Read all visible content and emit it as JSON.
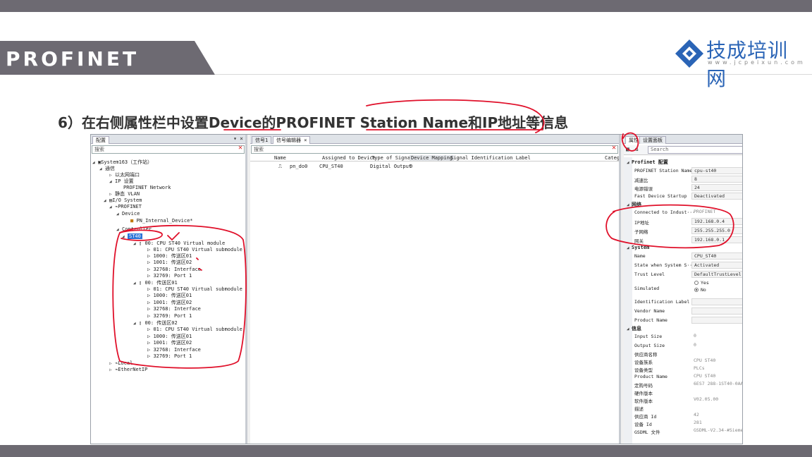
{
  "slide": {
    "title": "PROFINET",
    "logo_text": "技成培训网",
    "logo_url": "www.jcpeixun.com",
    "instruction": "6）在右侧属性栏中设置Device的PROFINET Station Name和IP地址等信息"
  },
  "colors": {
    "bar": "#6d6a72",
    "accent": "#2a64b6",
    "annotation": "#e0102a",
    "selection": "#2b74d8"
  },
  "left_pane": {
    "tab": "配置",
    "search_placeholder": "搜索",
    "tree": [
      {
        "label": "System163（工作站）"
      },
      {
        "label": "通信"
      },
      {
        "label": "以太网端口"
      },
      {
        "label": "IP 设置"
      },
      {
        "label": "PROFINET Network"
      },
      {
        "label": "静态 VLAN"
      },
      {
        "label": "I/O System"
      },
      {
        "label": "PROFINET"
      },
      {
        "label": "Device"
      },
      {
        "label": "PN_Internal_Device"
      },
      {
        "label": "Controller"
      },
      {
        "label": "ST40"
      },
      {
        "label": "00: CPU ST40 Virtual module"
      },
      {
        "label": "01: CPU ST40 Virtual submodule"
      },
      {
        "label": "1000: 传送区01"
      },
      {
        "label": "1001: 传送区02"
      },
      {
        "label": "32768: Interface"
      },
      {
        "label": "32769: Port 1"
      },
      {
        "label": "00: 传送区01"
      },
      {
        "label": "01: CPU ST40 Virtual submodule"
      },
      {
        "label": "1000: 传送区01"
      },
      {
        "label": "1001: 传送区02"
      },
      {
        "label": "32768: Interface"
      },
      {
        "label": "32769: Port 1"
      },
      {
        "label": "00: 传送区02"
      },
      {
        "label": "01: CPU ST40 Virtual submodule"
      },
      {
        "label": "1000: 传送区01"
      },
      {
        "label": "1001: 传送区02"
      },
      {
        "label": "32768: Interface"
      },
      {
        "label": "32769: Port 1"
      },
      {
        "label": "Local"
      },
      {
        "label": "EtherNetIP"
      }
    ]
  },
  "mid_pane": {
    "tabs": [
      "信号1",
      "信号编辑器"
    ],
    "search_placeholder": "搜索",
    "columns": [
      "Name",
      "Assigned to Device",
      "Type of Signal",
      "Device Mapping",
      "Signal Identification Label",
      "Catego"
    ],
    "rows": [
      {
        "name": "pn_do0",
        "device": "CPU_ST40",
        "type": "Digital Output",
        "mapping": "0"
      }
    ]
  },
  "right_pane": {
    "tabs": [
      "属性",
      "设置面板"
    ],
    "search_placeholder": "Search",
    "categories": {
      "profinet": "Profinet 配置",
      "network": "网络",
      "system": "System",
      "info": "信息"
    },
    "profinet_rows": [
      {
        "label": "PROFINET Station Name",
        "value": "cpu-st40"
      },
      {
        "label": "减速比",
        "value": "8"
      },
      {
        "label": "电源错误",
        "value": "24"
      },
      {
        "label": "Fast Device Startup",
        "value": "Deactivated"
      }
    ],
    "network_rows": [
      {
        "label": "Connected to Indust···",
        "value": "PROFINET"
      },
      {
        "label": "IP地址",
        "value": "192.168.0.4"
      },
      {
        "label": "子网络",
        "value": "255.255.255.0"
      },
      {
        "label": "网关",
        "value": "192.168.0.1"
      }
    ],
    "system_rows": [
      {
        "label": "Name",
        "value": "CPU_ST40"
      },
      {
        "label": "State when System S···",
        "value": "Activated"
      },
      {
        "label": "Trust Level",
        "value": "DefaultTrustLevel"
      }
    ],
    "simulated_label": "Simulated",
    "simulated_options": [
      "Yes",
      "No"
    ],
    "system_rows_2": [
      {
        "label": "Identification Label",
        "value": ""
      },
      {
        "label": "Vendor Name",
        "value": ""
      },
      {
        "label": "Product Name",
        "value": ""
      }
    ],
    "info_rows": [
      {
        "label": "Input Size",
        "value": "0"
      },
      {
        "label": "Output Size",
        "value": "0"
      },
      {
        "label": "供应商名称",
        "value": ""
      },
      {
        "label": "设备族系",
        "value": "CPU ST40"
      },
      {
        "label": "设备类型",
        "value": "PLCs"
      },
      {
        "label": "Product Name",
        "value": "CPU ST40"
      },
      {
        "label": "定购号码",
        "value": "6ES7 288-1ST40-0AA0"
      },
      {
        "label": "硬件版本",
        "value": ""
      },
      {
        "label": "软件版本",
        "value": "V02.05.00"
      },
      {
        "label": "描述",
        "value": ""
      },
      {
        "label": "供应商 Id",
        "value": "42"
      },
      {
        "label": "设备 Id",
        "value": "281"
      },
      {
        "label": "GSDML 文件",
        "value": "GSDML-V2.34-#Siemens-"
      }
    ]
  }
}
